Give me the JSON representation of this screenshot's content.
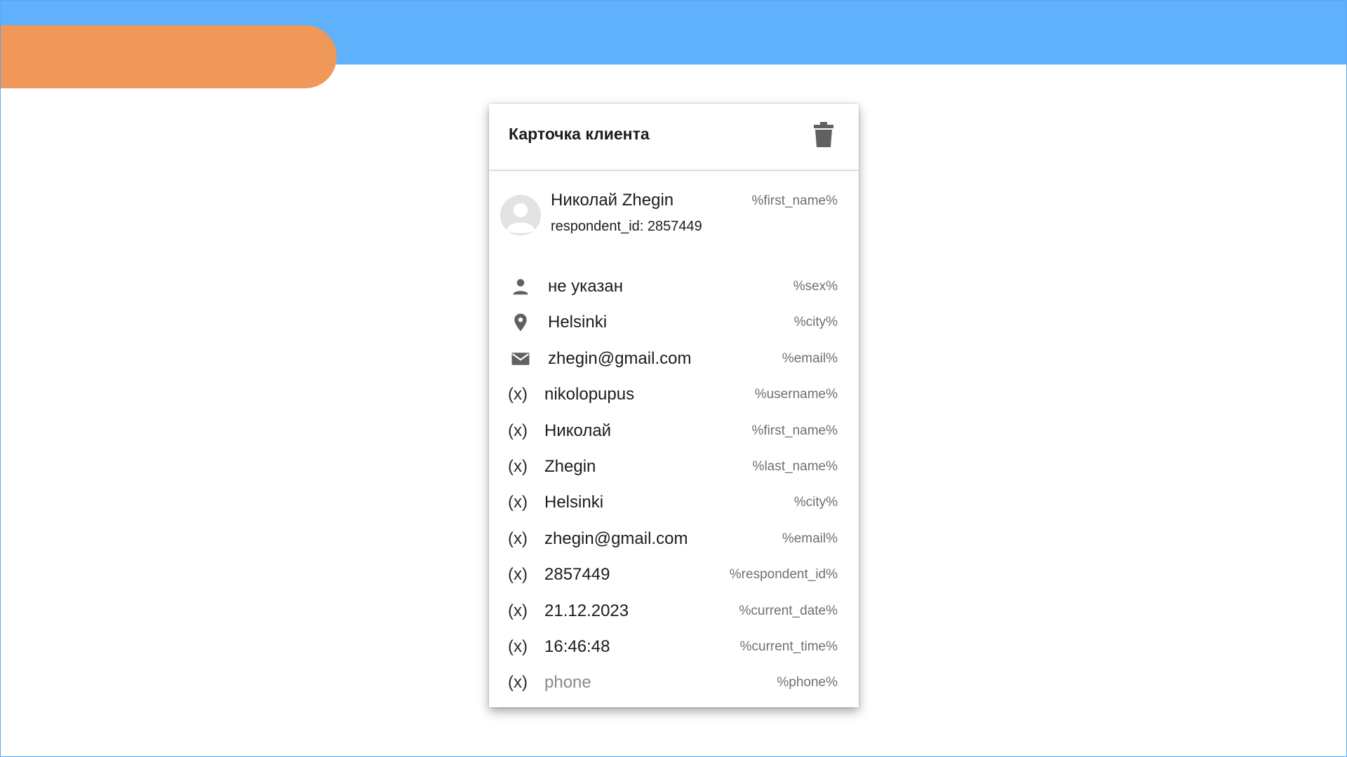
{
  "card": {
    "title": "Карточка клиента",
    "profile": {
      "name": "Николай Zhegin",
      "respondent_id_line": "respondent_id: 2857449",
      "variable": "%first_name%"
    },
    "fields": [
      {
        "icon": "person-icon",
        "value": "не указан",
        "variable": "%sex%"
      },
      {
        "icon": "location-pin-icon",
        "value": "Helsinki",
        "variable": "%city%"
      },
      {
        "icon": "mail-icon",
        "value": "zhegin@gmail.com",
        "variable": "%email%"
      }
    ],
    "variables": [
      {
        "marker": "(x)",
        "value": "nikolopupus",
        "variable": "%username%"
      },
      {
        "marker": "(x)",
        "value": "Николай",
        "variable": "%first_name%"
      },
      {
        "marker": "(x)",
        "value": "Zhegin",
        "variable": "%last_name%"
      },
      {
        "marker": "(x)",
        "value": "Helsinki",
        "variable": "%city%"
      },
      {
        "marker": "(x)",
        "value": "zhegin@gmail.com",
        "variable": "%email%"
      },
      {
        "marker": "(x)",
        "value": "2857449",
        "variable": "%respondent_id%"
      },
      {
        "marker": "(x)",
        "value": "21.12.2023",
        "variable": "%current_date%"
      },
      {
        "marker": "(x)",
        "value": "16:46:48",
        "variable": "%current_time%"
      },
      {
        "marker": "(x)",
        "value": "phone",
        "variable": "%phone%",
        "placeholder": true
      }
    ]
  },
  "colors": {
    "top_band": "#5eb1fa",
    "orange_accent": "#f0975a",
    "icon_gray": "#616161"
  }
}
